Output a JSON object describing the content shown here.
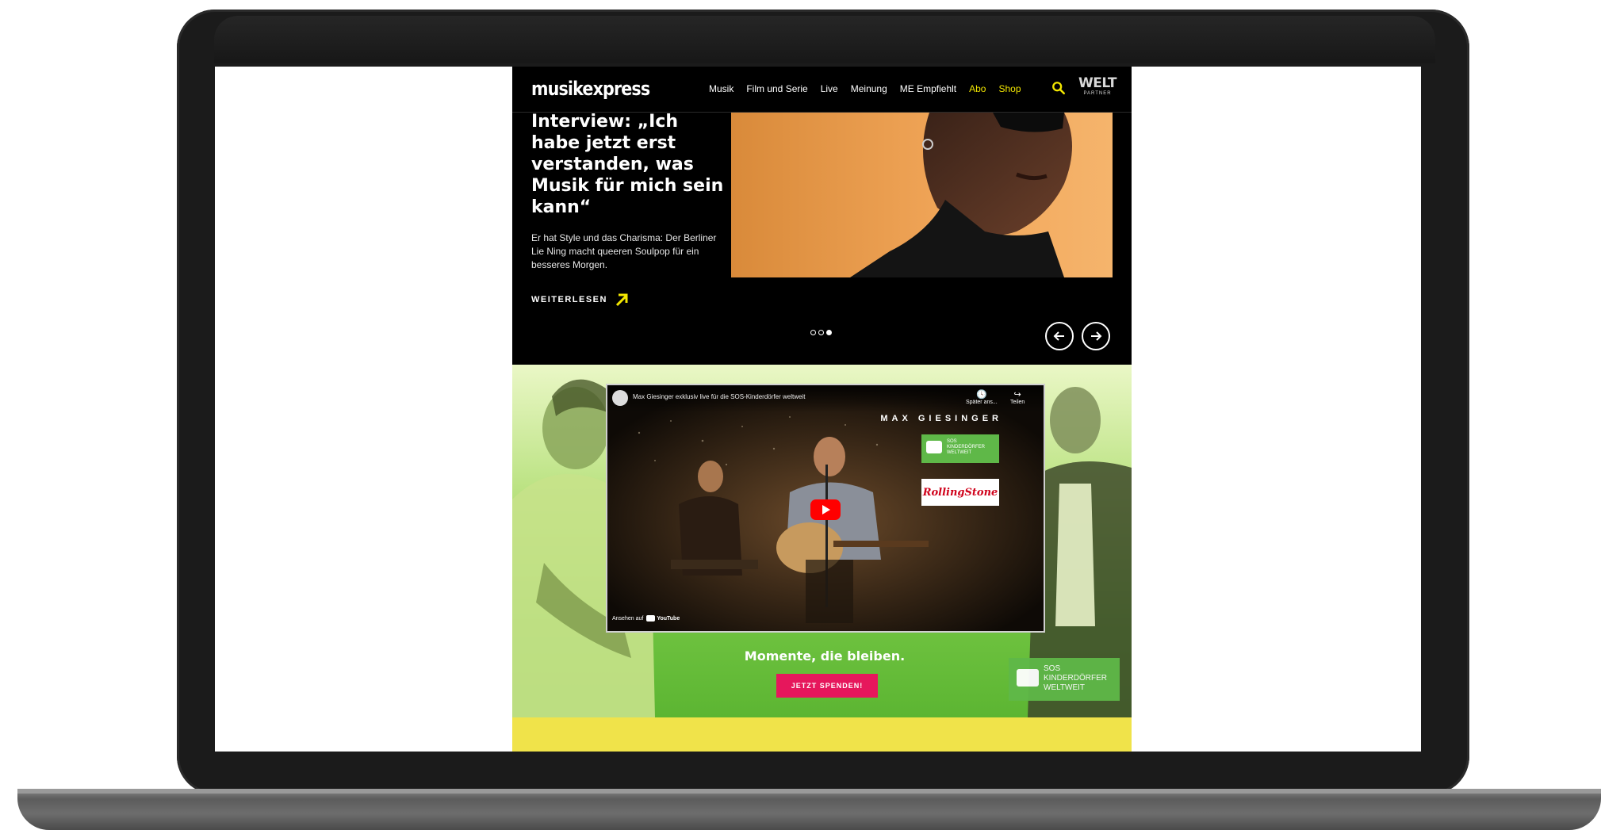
{
  "nav": {
    "logo": "musikexpress",
    "links": [
      "Musik",
      "Film und Serie",
      "Live",
      "Meinung",
      "ME Empfiehlt",
      "Abo",
      "Shop"
    ],
    "partner_name": "WELT",
    "partner_sub": "PARTNER",
    "search_icon": "search-icon",
    "accent_color": "#f2e600"
  },
  "hero": {
    "title": "Interview: „Ich habe jetzt erst verstanden, was Musik für mich sein kann“",
    "teaser": "Er hat Style und das Charisma: Der Berliner Lie Ning macht queeren Soulpop für ein besseres Morgen.",
    "read_more": "WEITERLESEN",
    "slide_count": 3,
    "active_slide": 3,
    "prev_icon": "arrow-left-icon",
    "next_icon": "arrow-right-icon"
  },
  "ad": {
    "video_title": "Max Giesinger exklusiv live für die SOS-Kinderdörfer weltweit",
    "watch_later": "Später ans...",
    "share": "Teilen",
    "artist": "MAX GIESINGER",
    "sos_lines": [
      "SOS",
      "KINDERDÖRFER",
      "WELTWEIT"
    ],
    "rolling_stone": "RollingStone",
    "watch_on": "Ansehen auf",
    "youtube": "YouTube",
    "claim": "Momente, die bleiben.",
    "donate": "JETZT SPENDEN!",
    "brand_color": "#5fb848",
    "donate_color": "#e6175c"
  }
}
